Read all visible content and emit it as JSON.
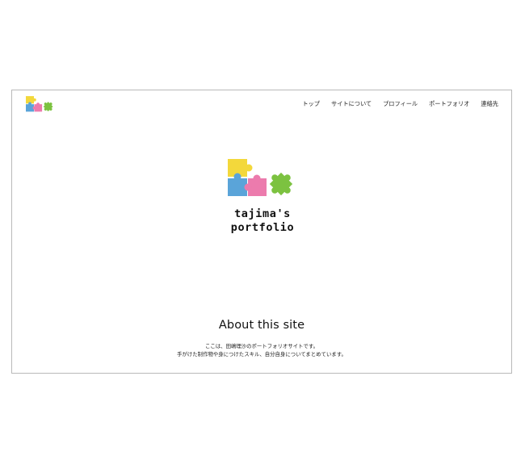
{
  "header": {
    "logo_icon": "puzzle-pieces-logo-icon",
    "nav_items": [
      "トップ",
      "サイトについて",
      "プロフィール",
      "ポートフォリオ",
      "連絡先"
    ]
  },
  "hero": {
    "logo_icon": "puzzle-pieces-logo-icon",
    "title_line1": "tajima's",
    "title_line2": "portfolio"
  },
  "about": {
    "heading": "About this site",
    "line1": "ここは、田嶋理沙のポートフォリオサイトです。",
    "line2": "手がけた制作物や身につけたスキル、自分自身についてまとめています。"
  },
  "colors": {
    "yellow": "#f3d83b",
    "blue": "#5aa4d9",
    "pink": "#ec7bad",
    "green": "#7cc240",
    "frame_border": "#b9b9b9"
  }
}
